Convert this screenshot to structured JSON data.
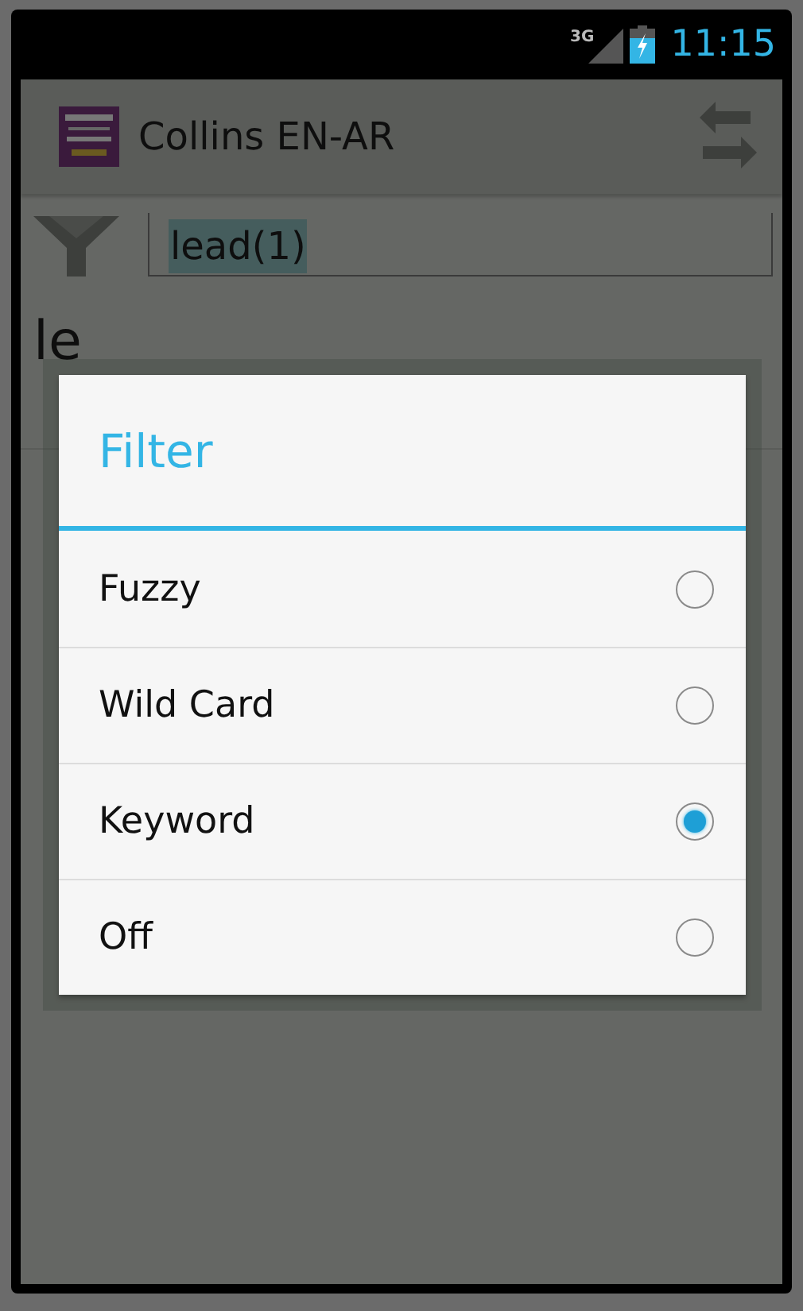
{
  "status_bar": {
    "network": "3G",
    "time": "11:15"
  },
  "action_bar": {
    "title": "Collins EN-AR"
  },
  "search": {
    "value": "lead(1)"
  },
  "result_heading": "le",
  "dialog": {
    "title": "Filter",
    "options": [
      {
        "label": "Fuzzy",
        "selected": false
      },
      {
        "label": "Wild Card",
        "selected": false
      },
      {
        "label": "Keyword",
        "selected": true
      },
      {
        "label": "Off",
        "selected": false
      }
    ]
  }
}
